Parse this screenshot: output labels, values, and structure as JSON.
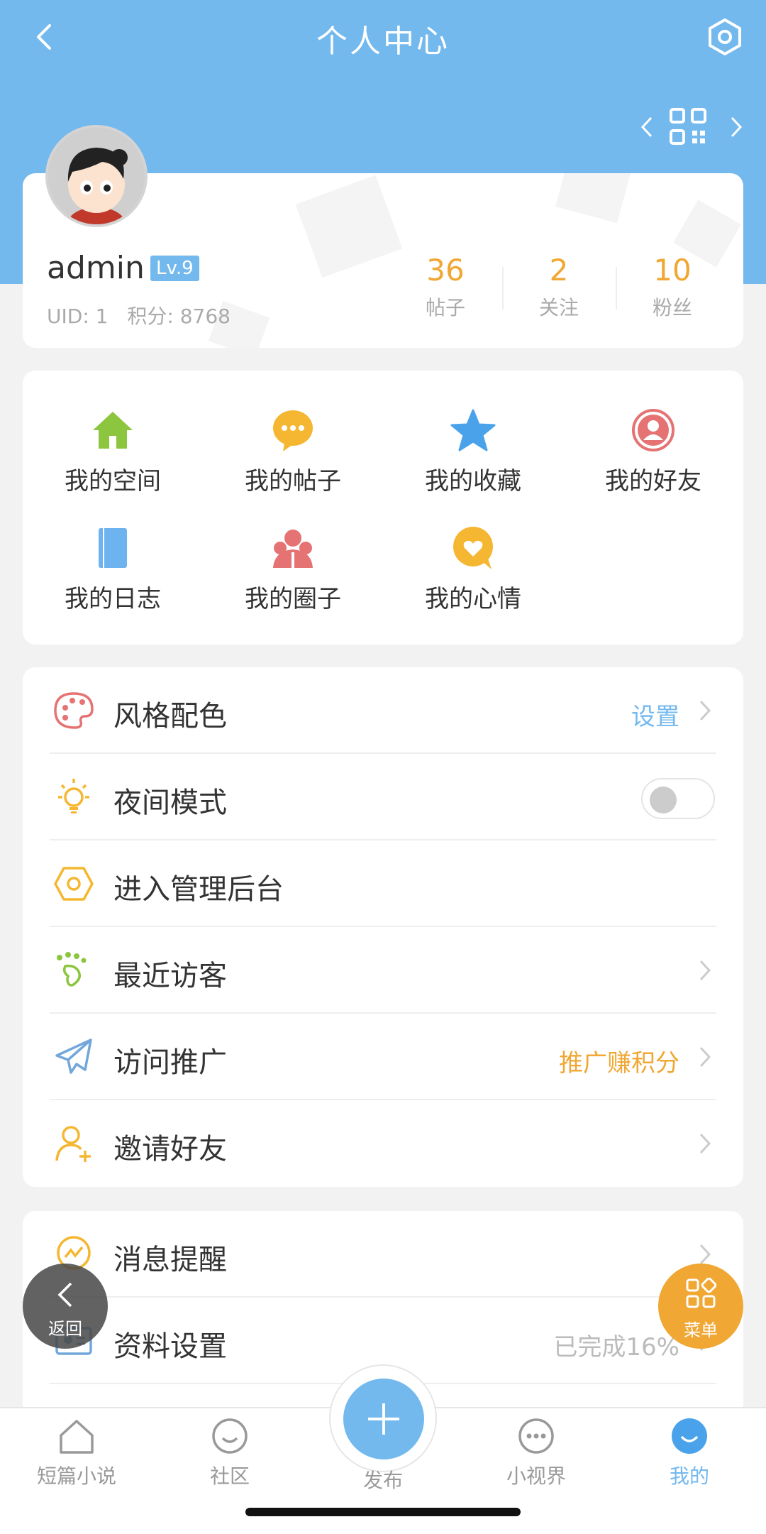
{
  "header": {
    "title": "个人中心",
    "bg_color": "#73b9ee"
  },
  "profile": {
    "username": "admin",
    "level": "Lv.9",
    "uid": "UID: 1",
    "points": "积分: 8768",
    "stats": [
      {
        "value": "36",
        "label": "帖子"
      },
      {
        "value": "2",
        "label": "关注"
      },
      {
        "value": "10",
        "label": "粉丝"
      }
    ]
  },
  "grid": {
    "items": [
      {
        "label": "我的空间",
        "icon": "house-icon",
        "color": "#8cc63f"
      },
      {
        "label": "我的帖子",
        "icon": "chat-bubble-icon",
        "color": "#f5b731"
      },
      {
        "label": "我的收藏",
        "icon": "star-icon",
        "color": "#4aa3ea"
      },
      {
        "label": "我的好友",
        "icon": "person-circle-icon",
        "color": "#e57373"
      },
      {
        "label": "我的日志",
        "icon": "notebook-icon",
        "color": "#6db3ef"
      },
      {
        "label": "我的圈子",
        "icon": "group-icon",
        "color": "#e57373"
      },
      {
        "label": "我的心情",
        "icon": "heart-bubble-icon",
        "color": "#f5b731"
      }
    ]
  },
  "menu": {
    "items": [
      {
        "label": "风格配色",
        "value": "设置",
        "value_color": "#73b9ee",
        "icon": "palette-icon"
      },
      {
        "label": "夜间模式",
        "icon": "bulb-icon",
        "toggle_on": false
      },
      {
        "label": "进入管理后台",
        "icon": "hexagon-icon"
      },
      {
        "label": "最近访客",
        "icon": "footprint-icon"
      },
      {
        "label": "访问推广",
        "value": "推广赚积分",
        "value_color": "#f0a733",
        "icon": "paper-plane-icon"
      },
      {
        "label": "邀请好友",
        "icon": "add-user-icon"
      }
    ]
  },
  "menu2": {
    "items": [
      {
        "label": "消息提醒",
        "icon": "message-icon"
      },
      {
        "label": "资料设置",
        "value": "已完成16%",
        "value_color": "#bbbbbb",
        "icon": "id-card-icon"
      }
    ]
  },
  "floating": {
    "back_label": "返回",
    "menu_label": "菜单"
  },
  "tabbar": {
    "items": [
      {
        "label": "短篇小说",
        "icon": "home-outline-icon"
      },
      {
        "label": "社区",
        "icon": "smile-bubble-icon"
      },
      {
        "label": "发布",
        "icon": "plus-icon"
      },
      {
        "label": "小视界",
        "icon": "dots-bubble-icon"
      },
      {
        "label": "我的",
        "icon": "profile-filled-icon",
        "active": true
      }
    ]
  }
}
